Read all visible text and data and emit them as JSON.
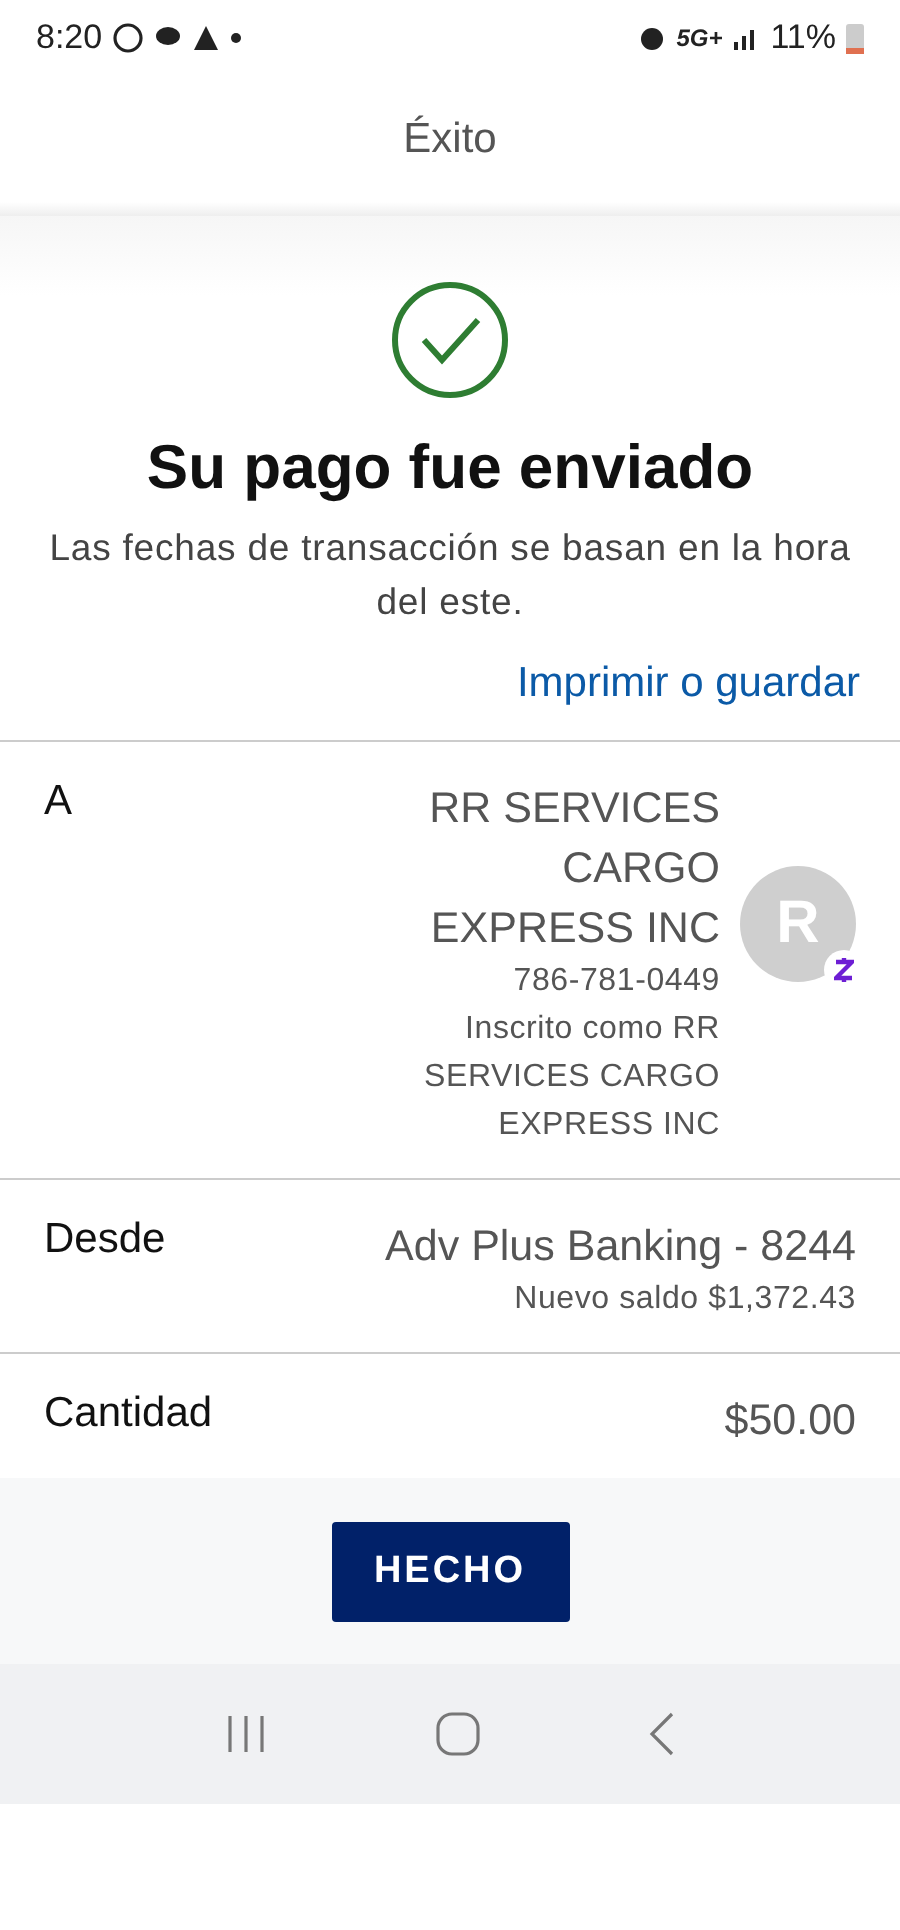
{
  "status_bar": {
    "time": "8:20",
    "network": "5G+",
    "battery": "11%"
  },
  "header": {
    "title": "Éxito"
  },
  "confirmation": {
    "title": "Su pago fue enviado",
    "subtitle": "Las fechas de transacción se basan en la hora del este.",
    "link": "Imprimir o guardar"
  },
  "details": [
    {
      "label": "A",
      "lines": [
        {
          "kind": "primary",
          "text": "RR SERVICES CARGO EXPRESS INC"
        },
        {
          "kind": "secondary",
          "text": "786-781-0449"
        },
        {
          "kind": "secondary",
          "text": "Inscrito como RR SERVICES CARGO EXPRESS INC"
        }
      ],
      "avatar": {
        "letter": "R"
      }
    },
    {
      "label": "Desde",
      "lines": [
        {
          "kind": "primary",
          "text": "Adv Plus Banking - 8244"
        },
        {
          "kind": "secondary",
          "text": "Nuevo saldo $1,372.43"
        }
      ]
    },
    {
      "label": "Cantidad",
      "lines": [
        {
          "kind": "primary",
          "text": "$50.00"
        }
      ]
    }
  ],
  "footer": {
    "button": "HECHO"
  }
}
